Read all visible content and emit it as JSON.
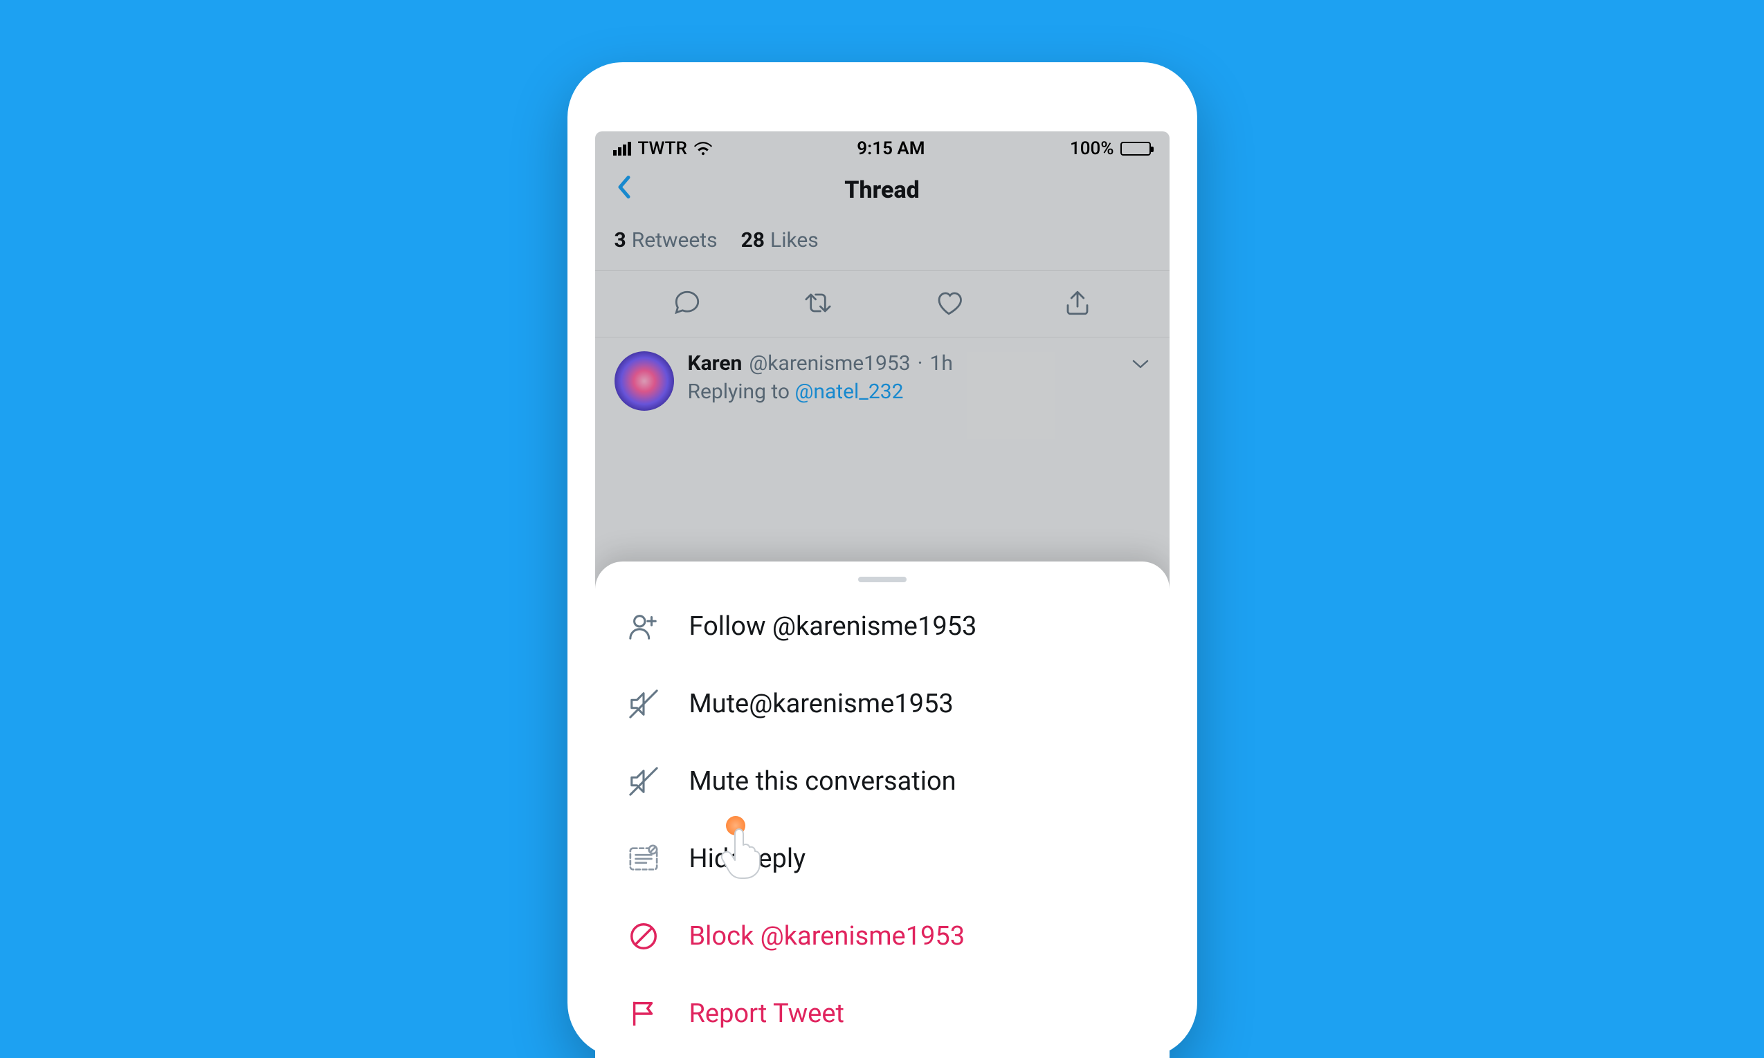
{
  "status_bar": {
    "carrier": "TWTR",
    "time": "9:15 AM",
    "battery_pct": "100%"
  },
  "nav": {
    "title": "Thread"
  },
  "stats": {
    "retweets_count": "3",
    "retweets_label": "Retweets",
    "likes_count": "28",
    "likes_label": "Likes"
  },
  "tweet": {
    "author_name": "Karen",
    "author_handle": "@karenisme1953",
    "timestamp": "1h",
    "separator": "·",
    "replying_to_label": "Replying to",
    "replying_to_handle": "@natel_232"
  },
  "action_sheet": {
    "items": [
      {
        "label": "Follow @karenisme1953",
        "icon": "follow-icon",
        "destructive": false
      },
      {
        "label": "Mute@karenisme1953",
        "icon": "mute-icon",
        "destructive": false
      },
      {
        "label": "Mute this conversation",
        "icon": "mute-icon",
        "destructive": false
      },
      {
        "label": "Hide reply",
        "icon": "hide-reply-icon",
        "destructive": false
      },
      {
        "label": "Block @karenisme1953",
        "icon": "block-icon",
        "destructive": true
      },
      {
        "label": "Report Tweet",
        "icon": "report-icon",
        "destructive": true
      }
    ]
  }
}
